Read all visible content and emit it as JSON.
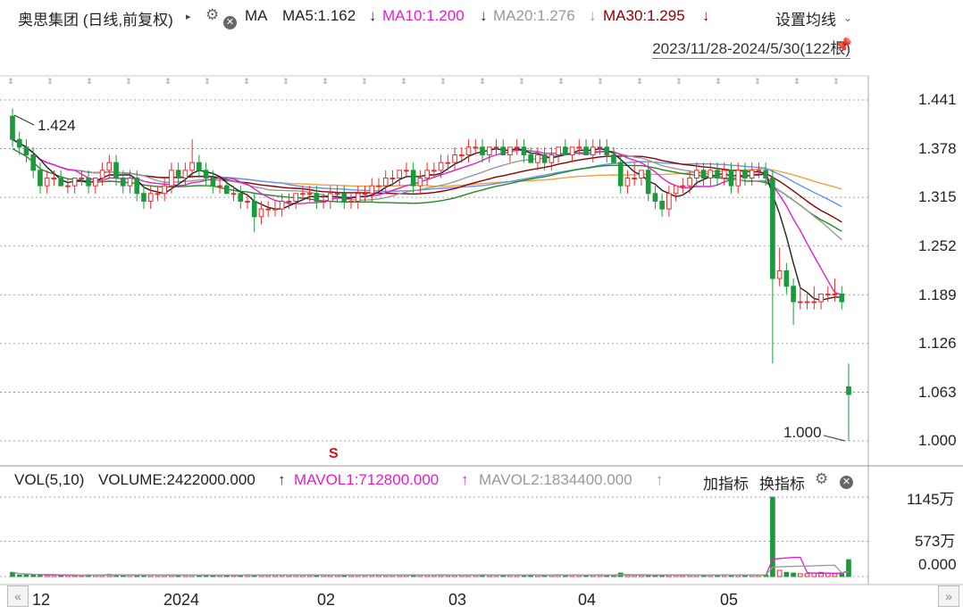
{
  "header": {
    "stock_title": "奥思集团 (日线,前复权)",
    "ma_label": "MA",
    "ma5": {
      "text": "MA5:1.162",
      "arrow": "↓",
      "color": "#222222"
    },
    "ma10": {
      "text": "MA10:1.200",
      "arrow": "↓",
      "color": "#e020c8"
    },
    "ma20": {
      "text": "MA20:1.276",
      "arrow": "↓",
      "color": "#999999"
    },
    "ma30": {
      "text": "MA30:1.295",
      "arrow": "↓",
      "color": "#8b0000"
    },
    "settings_label": "设置均线",
    "range_label": "2023/11/28-2024/5/30(122根)"
  },
  "price_axis": {
    "ticks": [
      "1.441",
      "1.378",
      "1.315",
      "1.252",
      "1.189",
      "1.126",
      "1.063",
      "1.000"
    ]
  },
  "annotations": {
    "high": "1.424",
    "low": "1.000",
    "signal": "S"
  },
  "volume_header": {
    "vol_label": "VOL(5,10)",
    "volume": {
      "text": "VOLUME:2422000.000",
      "arrow": "↑"
    },
    "mavol1": {
      "text": "MAVOL1:712800.000",
      "arrow": "↑",
      "color": "#e020c8"
    },
    "mavol2": {
      "text": "MAVOL2:1834400.000",
      "arrow": "↑",
      "color": "#999999"
    },
    "add_indicator": "加指标",
    "switch_indicator": "换指标"
  },
  "volume_axis": {
    "ticks": [
      "1145万",
      "573万",
      "0.000"
    ]
  },
  "x_axis": {
    "labels": [
      "12",
      "2024",
      "02",
      "03",
      "04",
      "05"
    ]
  },
  "colors": {
    "up": "#e03030",
    "down": "#1a9a3a",
    "ma60": "#6495ed",
    "ma_long": "#f0a040",
    "ma_green": "#228b22",
    "grid": "#888888"
  },
  "chart_data": {
    "type": "candlestick",
    "period": "2023/11/28-2024/5/30",
    "bar_count": 122,
    "ylim": [
      1.0,
      1.441
    ],
    "yticks": [
      1.441,
      1.378,
      1.315,
      1.252,
      1.189,
      1.126,
      1.063,
      1.0
    ],
    "high_marker": 1.424,
    "low_marker": 1.0,
    "month_labels": [
      "12",
      "2024",
      "02",
      "03",
      "04",
      "05"
    ],
    "ohlc": [
      [
        1.42,
        1.43,
        1.38,
        1.39
      ],
      [
        1.39,
        1.4,
        1.37,
        1.38
      ],
      [
        1.38,
        1.39,
        1.36,
        1.37
      ],
      [
        1.37,
        1.38,
        1.34,
        1.35
      ],
      [
        1.35,
        1.36,
        1.32,
        1.33
      ],
      [
        1.33,
        1.35,
        1.32,
        1.34
      ],
      [
        1.34,
        1.35,
        1.33,
        1.34
      ],
      [
        1.34,
        1.35,
        1.33,
        1.33
      ],
      [
        1.33,
        1.34,
        1.32,
        1.33
      ],
      [
        1.33,
        1.34,
        1.32,
        1.34
      ],
      [
        1.34,
        1.35,
        1.33,
        1.34
      ],
      [
        1.34,
        1.35,
        1.32,
        1.33
      ],
      [
        1.33,
        1.34,
        1.32,
        1.34
      ],
      [
        1.34,
        1.36,
        1.33,
        1.35
      ],
      [
        1.35,
        1.37,
        1.34,
        1.36
      ],
      [
        1.36,
        1.37,
        1.33,
        1.34
      ],
      [
        1.34,
        1.35,
        1.32,
        1.33
      ],
      [
        1.33,
        1.35,
        1.32,
        1.34
      ],
      [
        1.34,
        1.35,
        1.31,
        1.32
      ],
      [
        1.32,
        1.33,
        1.3,
        1.31
      ],
      [
        1.31,
        1.33,
        1.3,
        1.32
      ],
      [
        1.32,
        1.33,
        1.31,
        1.32
      ],
      [
        1.32,
        1.34,
        1.31,
        1.33
      ],
      [
        1.33,
        1.36,
        1.32,
        1.35
      ],
      [
        1.35,
        1.36,
        1.33,
        1.34
      ],
      [
        1.34,
        1.36,
        1.33,
        1.35
      ],
      [
        1.35,
        1.39,
        1.34,
        1.36
      ],
      [
        1.36,
        1.37,
        1.34,
        1.35
      ],
      [
        1.35,
        1.36,
        1.33,
        1.34
      ],
      [
        1.34,
        1.35,
        1.32,
        1.33
      ],
      [
        1.33,
        1.34,
        1.32,
        1.33
      ],
      [
        1.33,
        1.34,
        1.32,
        1.32
      ],
      [
        1.32,
        1.33,
        1.31,
        1.32
      ],
      [
        1.32,
        1.33,
        1.3,
        1.31
      ],
      [
        1.31,
        1.32,
        1.3,
        1.31
      ],
      [
        1.31,
        1.32,
        1.27,
        1.29
      ],
      [
        1.29,
        1.31,
        1.28,
        1.3
      ],
      [
        1.3,
        1.31,
        1.29,
        1.3
      ],
      [
        1.3,
        1.31,
        1.29,
        1.3
      ],
      [
        1.3,
        1.32,
        1.29,
        1.31
      ],
      [
        1.31,
        1.32,
        1.3,
        1.31
      ],
      [
        1.31,
        1.32,
        1.3,
        1.32
      ],
      [
        1.32,
        1.33,
        1.31,
        1.32
      ],
      [
        1.32,
        1.33,
        1.31,
        1.32
      ],
      [
        1.32,
        1.33,
        1.3,
        1.31
      ],
      [
        1.31,
        1.32,
        1.3,
        1.31
      ],
      [
        1.31,
        1.33,
        1.3,
        1.32
      ],
      [
        1.32,
        1.33,
        1.31,
        1.32
      ],
      [
        1.32,
        1.33,
        1.3,
        1.31
      ],
      [
        1.31,
        1.32,
        1.3,
        1.31
      ],
      [
        1.31,
        1.33,
        1.3,
        1.32
      ],
      [
        1.32,
        1.33,
        1.31,
        1.32
      ],
      [
        1.32,
        1.34,
        1.31,
        1.33
      ],
      [
        1.33,
        1.34,
        1.32,
        1.33
      ],
      [
        1.33,
        1.35,
        1.32,
        1.34
      ],
      [
        1.34,
        1.35,
        1.33,
        1.34
      ],
      [
        1.34,
        1.35,
        1.33,
        1.35
      ],
      [
        1.35,
        1.36,
        1.34,
        1.35
      ],
      [
        1.35,
        1.36,
        1.32,
        1.33
      ],
      [
        1.33,
        1.35,
        1.32,
        1.34
      ],
      [
        1.34,
        1.36,
        1.33,
        1.35
      ],
      [
        1.35,
        1.36,
        1.34,
        1.35
      ],
      [
        1.35,
        1.37,
        1.34,
        1.36
      ],
      [
        1.36,
        1.37,
        1.35,
        1.36
      ],
      [
        1.36,
        1.38,
        1.35,
        1.37
      ],
      [
        1.37,
        1.38,
        1.36,
        1.37
      ],
      [
        1.37,
        1.39,
        1.36,
        1.38
      ],
      [
        1.38,
        1.39,
        1.37,
        1.38
      ],
      [
        1.38,
        1.39,
        1.36,
        1.37
      ],
      [
        1.37,
        1.38,
        1.36,
        1.38
      ],
      [
        1.38,
        1.39,
        1.37,
        1.38
      ],
      [
        1.38,
        1.39,
        1.37,
        1.37
      ],
      [
        1.37,
        1.38,
        1.36,
        1.38
      ],
      [
        1.38,
        1.39,
        1.37,
        1.38
      ],
      [
        1.38,
        1.39,
        1.36,
        1.37
      ],
      [
        1.37,
        1.38,
        1.36,
        1.36
      ],
      [
        1.36,
        1.38,
        1.35,
        1.37
      ],
      [
        1.37,
        1.38,
        1.35,
        1.36
      ],
      [
        1.36,
        1.38,
        1.35,
        1.37
      ],
      [
        1.37,
        1.38,
        1.36,
        1.38
      ],
      [
        1.38,
        1.39,
        1.37,
        1.37
      ],
      [
        1.37,
        1.38,
        1.36,
        1.38
      ],
      [
        1.38,
        1.39,
        1.37,
        1.38
      ],
      [
        1.38,
        1.39,
        1.37,
        1.37
      ],
      [
        1.37,
        1.39,
        1.36,
        1.38
      ],
      [
        1.38,
        1.39,
        1.37,
        1.38
      ],
      [
        1.38,
        1.39,
        1.36,
        1.37
      ],
      [
        1.37,
        1.38,
        1.36,
        1.36
      ],
      [
        1.36,
        1.37,
        1.32,
        1.33
      ],
      [
        1.33,
        1.35,
        1.32,
        1.34
      ],
      [
        1.34,
        1.36,
        1.33,
        1.34
      ],
      [
        1.34,
        1.35,
        1.33,
        1.35
      ],
      [
        1.35,
        1.36,
        1.31,
        1.32
      ],
      [
        1.32,
        1.33,
        1.3,
        1.31
      ],
      [
        1.31,
        1.32,
        1.29,
        1.3
      ],
      [
        1.3,
        1.33,
        1.29,
        1.32
      ],
      [
        1.32,
        1.33,
        1.31,
        1.33
      ],
      [
        1.33,
        1.34,
        1.32,
        1.33
      ],
      [
        1.33,
        1.35,
        1.32,
        1.34
      ],
      [
        1.34,
        1.36,
        1.33,
        1.35
      ],
      [
        1.35,
        1.36,
        1.33,
        1.34
      ],
      [
        1.34,
        1.36,
        1.33,
        1.35
      ],
      [
        1.35,
        1.36,
        1.33,
        1.34
      ],
      [
        1.34,
        1.36,
        1.33,
        1.35
      ],
      [
        1.35,
        1.36,
        1.32,
        1.33
      ],
      [
        1.33,
        1.36,
        1.32,
        1.35
      ],
      [
        1.35,
        1.36,
        1.33,
        1.34
      ],
      [
        1.34,
        1.36,
        1.33,
        1.35
      ],
      [
        1.35,
        1.36,
        1.34,
        1.35
      ],
      [
        1.35,
        1.36,
        1.33,
        1.34
      ],
      [
        1.34,
        1.35,
        1.1,
        1.21
      ],
      [
        1.21,
        1.25,
        1.2,
        1.22
      ],
      [
        1.22,
        1.23,
        1.19,
        1.2
      ],
      [
        1.2,
        1.21,
        1.15,
        1.18
      ],
      [
        1.18,
        1.2,
        1.17,
        1.18
      ],
      [
        1.18,
        1.19,
        1.17,
        1.18
      ],
      [
        1.18,
        1.2,
        1.17,
        1.18
      ],
      [
        1.18,
        1.19,
        1.17,
        1.19
      ],
      [
        1.19,
        1.2,
        1.18,
        1.19
      ],
      [
        1.19,
        1.21,
        1.18,
        1.19
      ],
      [
        1.19,
        1.2,
        1.17,
        1.18
      ],
      [
        1.07,
        1.1,
        1.0,
        1.06
      ]
    ],
    "volume_yticks": [
      "1145万",
      "573万",
      "0.000"
    ],
    "volume": [
      60,
      20,
      30,
      20,
      25,
      20,
      20,
      15,
      20,
      15,
      20,
      25,
      20,
      20,
      30,
      25,
      20,
      20,
      20,
      25,
      20,
      20,
      20,
      25,
      20,
      20,
      20,
      20,
      20,
      15,
      20,
      20,
      20,
      20,
      25,
      20,
      20,
      20,
      20,
      20,
      20,
      20,
      20,
      25,
      20,
      20,
      20,
      20,
      20,
      20,
      20,
      20,
      20,
      25,
      20,
      20,
      20,
      20,
      25,
      20,
      20,
      20,
      25,
      20,
      20,
      20,
      20,
      20,
      25,
      20,
      20,
      20,
      20,
      20,
      20,
      25,
      20,
      20,
      20,
      25,
      20,
      20,
      20,
      20,
      20,
      25,
      20,
      20,
      50,
      20,
      20,
      20,
      20,
      20,
      25,
      20,
      20,
      25,
      20,
      20,
      20,
      20,
      20,
      25,
      20,
      20,
      20,
      20,
      20,
      25,
      1145,
      90,
      60,
      50,
      40,
      40,
      50,
      60,
      50,
      40,
      50,
      242
    ]
  }
}
